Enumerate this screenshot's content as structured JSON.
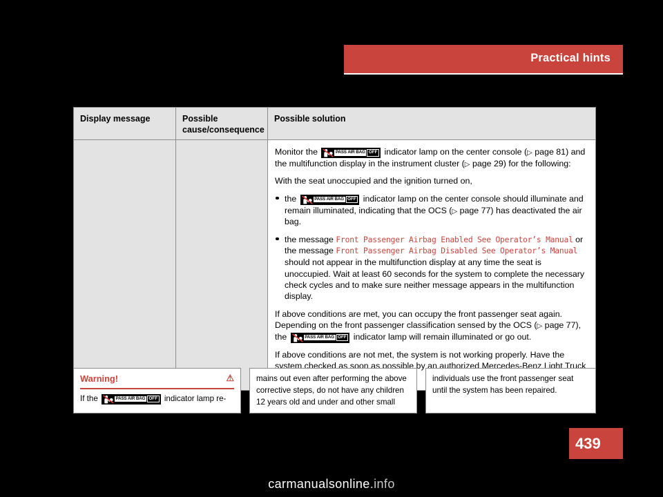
{
  "header": {
    "title": "Practical hints"
  },
  "table": {
    "headers": {
      "col1": "Display message",
      "col2": "Possible cause/consequence",
      "col3": "Possible solution"
    },
    "solution": {
      "p1_a": "Monitor the",
      "p1_b": "indicator lamp on the center console (",
      "p1_ref1": "page 81",
      "p1_c": ") and the multifunction display in the instrument cluster (",
      "p1_ref2": "page 29",
      "p1_d": ") for the following:",
      "p2": "With the seat unoccupied and the ignition turned on,",
      "b1_a": "the",
      "b1_b": "indicator lamp on the center console should illuminate and remain illuminated, indicating that the OCS (",
      "b1_ref": "page 77",
      "b1_c": ") has deactivated the air bag.",
      "b2_a": "the message",
      "b2_msg1": "Front Passenger Airbag Enabled See Operator’s Manual",
      "b2_b": "or the message",
      "b2_msg2": "Front Passenger Airbag Disabled See Operator’s Manual",
      "b2_c": "should not appear in the multifunction display at any time the seat is unoccupied. Wait at least 60 seconds for the system to complete the necessary check cycles and to make sure neither message appears in the multifunction display.",
      "p3_a": "If above conditions are met, you can occupy the front passenger seat again. Depending on the front passenger classification sensed by the OCS (",
      "p3_ref": "page 77",
      "p3_b": "), the",
      "p3_c": "indicator lamp will remain illuminated or go out.",
      "p4": "If above conditions are not met, the system is not working properly. Have the system checked as soon as possible by an authorized Mercedes-Benz Light Truck Center."
    }
  },
  "warning_boxes": [
    {
      "title": "Warning!",
      "text_a": "If the",
      "text_b": "indicator lamp re-"
    },
    {
      "text": "mains out even after performing the above corrective steps, do not have any children 12 years old and under and other small"
    },
    {
      "text": "individuals use the front passenger seat until the system has been repaired."
    }
  ],
  "page_number": "439",
  "watermark": {
    "main": "carmanualsonline",
    "suffix": ".info"
  },
  "icons": {
    "airbag_off_label": "PASS AIR BAG",
    "airbag_off_state": "OFF",
    "reference_triangle": "▷",
    "warning_triangle": "⚠"
  },
  "colors": {
    "accent": "#c8443c",
    "header_bg": "#e3e3e3",
    "border": "#8d8d8d"
  }
}
